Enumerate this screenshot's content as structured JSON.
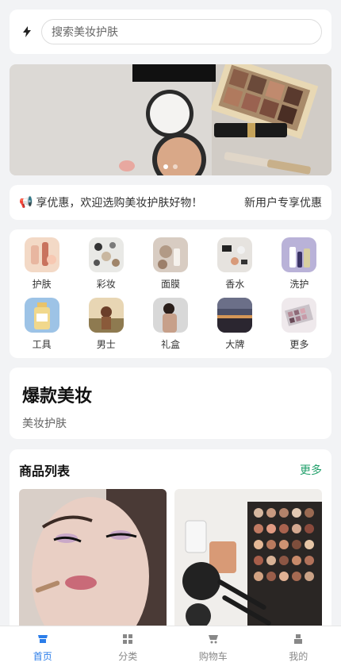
{
  "search": {
    "logo_icon": "lightning-icon",
    "placeholder": "搜索美妆护肤"
  },
  "banner": {
    "dots": 2,
    "active_dot": 0
  },
  "notice": {
    "icon": "megaphone-icon",
    "text": "享优惠，欢迎选购美妆护肤好物！",
    "right_text": "新用户专享优惠"
  },
  "categories": [
    {
      "label": "护肤",
      "icon": "skincare-icon"
    },
    {
      "label": "彩妆",
      "icon": "makeup-icon"
    },
    {
      "label": "面膜",
      "icon": "mask-icon"
    },
    {
      "label": "香水",
      "icon": "perfume-icon"
    },
    {
      "label": "洗护",
      "icon": "wash-icon"
    },
    {
      "label": "工具",
      "icon": "tools-icon"
    },
    {
      "label": "男士",
      "icon": "men-icon"
    },
    {
      "label": "礼盒",
      "icon": "gift-icon"
    },
    {
      "label": "大牌",
      "icon": "brand-icon"
    },
    {
      "label": "更多",
      "icon": "more-icon"
    }
  ],
  "promo": {
    "title": "爆款美妆",
    "subtitle": "美妆护肤"
  },
  "product_list": {
    "title": "商品列表",
    "more": "更多"
  },
  "tabbar": {
    "tabs": [
      {
        "label": "首页",
        "icon": "home-icon",
        "active": true
      },
      {
        "label": "分类",
        "icon": "category-icon",
        "active": false
      },
      {
        "label": "购物车",
        "icon": "cart-icon",
        "active": false
      },
      {
        "label": "我的",
        "icon": "user-icon",
        "active": false
      }
    ]
  },
  "colors": {
    "accent": "#2b7de9",
    "more_link": "#22a06b",
    "page_bg": "#f2f3f5"
  }
}
